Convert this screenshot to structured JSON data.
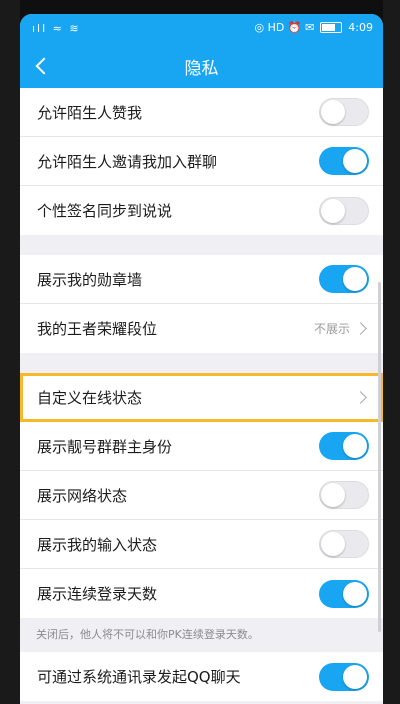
{
  "header": {
    "title": "隐私"
  },
  "status_bar": {
    "time": "4:09",
    "left_icons": "ıll ≈ ≋",
    "right_icons": "◎ HD ⏰ ✉"
  },
  "groups": [
    [
      {
        "label": "允许陌生人赞我",
        "toggle": "off"
      },
      {
        "label": "允许陌生人邀请我加入群聊",
        "toggle": "on"
      },
      {
        "label": "个性签名同步到说说",
        "toggle": "off"
      }
    ],
    [
      {
        "label": "展示我的勋章墙",
        "toggle": "on"
      },
      {
        "label": "我的王者荣耀段位",
        "value": "不展示"
      }
    ],
    [
      {
        "label": "自定义在线状态",
        "chevron": true,
        "highlight": true
      },
      {
        "label": "展示靓号群群主身份",
        "toggle": "on"
      },
      {
        "label": "展示网络状态",
        "toggle": "off"
      },
      {
        "label": "展示我的输入状态",
        "toggle": "off"
      },
      {
        "label": "展示连续登录天数",
        "toggle": "on"
      }
    ]
  ],
  "note": "关闭后，他人将不可以和你PK连续登录天数。",
  "last_row": {
    "label": "可通过系统通讯录发起QQ聊天",
    "toggle": "on"
  },
  "colors": {
    "accent": "#18a6f2",
    "highlight": "#f5b92a"
  }
}
